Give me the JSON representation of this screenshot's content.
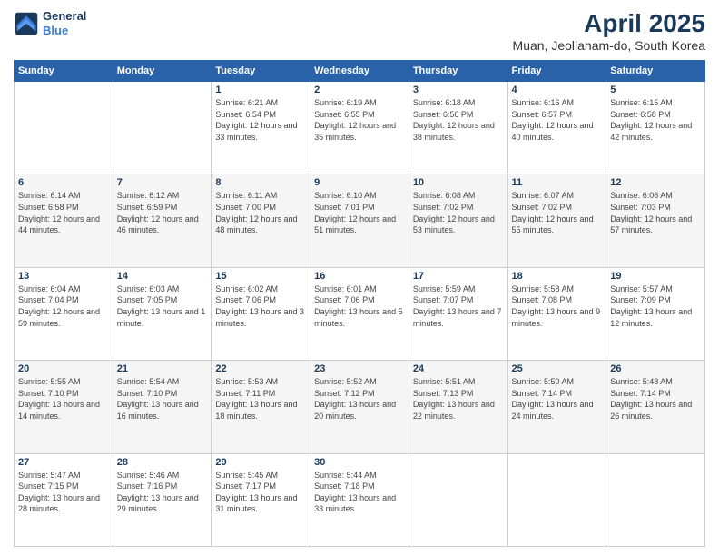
{
  "logo": {
    "line1": "General",
    "line2": "Blue"
  },
  "title": "April 2025",
  "subtitle": "Muan, Jeollanam-do, South Korea",
  "days_header": [
    "Sunday",
    "Monday",
    "Tuesday",
    "Wednesday",
    "Thursday",
    "Friday",
    "Saturday"
  ],
  "weeks": [
    [
      {
        "num": "",
        "info": ""
      },
      {
        "num": "",
        "info": ""
      },
      {
        "num": "1",
        "info": "Sunrise: 6:21 AM\nSunset: 6:54 PM\nDaylight: 12 hours and 33 minutes."
      },
      {
        "num": "2",
        "info": "Sunrise: 6:19 AM\nSunset: 6:55 PM\nDaylight: 12 hours and 35 minutes."
      },
      {
        "num": "3",
        "info": "Sunrise: 6:18 AM\nSunset: 6:56 PM\nDaylight: 12 hours and 38 minutes."
      },
      {
        "num": "4",
        "info": "Sunrise: 6:16 AM\nSunset: 6:57 PM\nDaylight: 12 hours and 40 minutes."
      },
      {
        "num": "5",
        "info": "Sunrise: 6:15 AM\nSunset: 6:58 PM\nDaylight: 12 hours and 42 minutes."
      }
    ],
    [
      {
        "num": "6",
        "info": "Sunrise: 6:14 AM\nSunset: 6:58 PM\nDaylight: 12 hours and 44 minutes."
      },
      {
        "num": "7",
        "info": "Sunrise: 6:12 AM\nSunset: 6:59 PM\nDaylight: 12 hours and 46 minutes."
      },
      {
        "num": "8",
        "info": "Sunrise: 6:11 AM\nSunset: 7:00 PM\nDaylight: 12 hours and 48 minutes."
      },
      {
        "num": "9",
        "info": "Sunrise: 6:10 AM\nSunset: 7:01 PM\nDaylight: 12 hours and 51 minutes."
      },
      {
        "num": "10",
        "info": "Sunrise: 6:08 AM\nSunset: 7:02 PM\nDaylight: 12 hours and 53 minutes."
      },
      {
        "num": "11",
        "info": "Sunrise: 6:07 AM\nSunset: 7:02 PM\nDaylight: 12 hours and 55 minutes."
      },
      {
        "num": "12",
        "info": "Sunrise: 6:06 AM\nSunset: 7:03 PM\nDaylight: 12 hours and 57 minutes."
      }
    ],
    [
      {
        "num": "13",
        "info": "Sunrise: 6:04 AM\nSunset: 7:04 PM\nDaylight: 12 hours and 59 minutes."
      },
      {
        "num": "14",
        "info": "Sunrise: 6:03 AM\nSunset: 7:05 PM\nDaylight: 13 hours and 1 minute."
      },
      {
        "num": "15",
        "info": "Sunrise: 6:02 AM\nSunset: 7:06 PM\nDaylight: 13 hours and 3 minutes."
      },
      {
        "num": "16",
        "info": "Sunrise: 6:01 AM\nSunset: 7:06 PM\nDaylight: 13 hours and 5 minutes."
      },
      {
        "num": "17",
        "info": "Sunrise: 5:59 AM\nSunset: 7:07 PM\nDaylight: 13 hours and 7 minutes."
      },
      {
        "num": "18",
        "info": "Sunrise: 5:58 AM\nSunset: 7:08 PM\nDaylight: 13 hours and 9 minutes."
      },
      {
        "num": "19",
        "info": "Sunrise: 5:57 AM\nSunset: 7:09 PM\nDaylight: 13 hours and 12 minutes."
      }
    ],
    [
      {
        "num": "20",
        "info": "Sunrise: 5:55 AM\nSunset: 7:10 PM\nDaylight: 13 hours and 14 minutes."
      },
      {
        "num": "21",
        "info": "Sunrise: 5:54 AM\nSunset: 7:10 PM\nDaylight: 13 hours and 16 minutes."
      },
      {
        "num": "22",
        "info": "Sunrise: 5:53 AM\nSunset: 7:11 PM\nDaylight: 13 hours and 18 minutes."
      },
      {
        "num": "23",
        "info": "Sunrise: 5:52 AM\nSunset: 7:12 PM\nDaylight: 13 hours and 20 minutes."
      },
      {
        "num": "24",
        "info": "Sunrise: 5:51 AM\nSunset: 7:13 PM\nDaylight: 13 hours and 22 minutes."
      },
      {
        "num": "25",
        "info": "Sunrise: 5:50 AM\nSunset: 7:14 PM\nDaylight: 13 hours and 24 minutes."
      },
      {
        "num": "26",
        "info": "Sunrise: 5:48 AM\nSunset: 7:14 PM\nDaylight: 13 hours and 26 minutes."
      }
    ],
    [
      {
        "num": "27",
        "info": "Sunrise: 5:47 AM\nSunset: 7:15 PM\nDaylight: 13 hours and 28 minutes."
      },
      {
        "num": "28",
        "info": "Sunrise: 5:46 AM\nSunset: 7:16 PM\nDaylight: 13 hours and 29 minutes."
      },
      {
        "num": "29",
        "info": "Sunrise: 5:45 AM\nSunset: 7:17 PM\nDaylight: 13 hours and 31 minutes."
      },
      {
        "num": "30",
        "info": "Sunrise: 5:44 AM\nSunset: 7:18 PM\nDaylight: 13 hours and 33 minutes."
      },
      {
        "num": "",
        "info": ""
      },
      {
        "num": "",
        "info": ""
      },
      {
        "num": "",
        "info": ""
      }
    ]
  ]
}
